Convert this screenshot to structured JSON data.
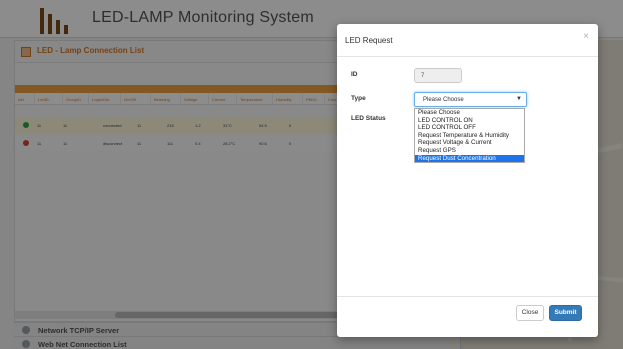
{
  "app": {
    "title": "LED-LAMP Monitoring System"
  },
  "panel": {
    "title": "LED - Lamp Connection List",
    "columns": [
      "Alrt",
      "LedID",
      "GroupID",
      "Login/Out",
      "On/Off",
      "Beaming",
      "Voltage",
      "Current",
      "Temperature",
      "Humidity",
      "PM10",
      "Conn"
    ],
    "rows": [
      {
        "status_color": "#27a844",
        "led_id": "11",
        "group_id": "11",
        "login": "connected",
        "onoff": "11",
        "voltage": "215",
        "current": "1.2",
        "temperature": "31°C",
        "humidity": "54.9",
        "pm10": "0"
      },
      {
        "status_color": "#d9433a",
        "led_id": "11",
        "group_id": "11",
        "login": "disconnect",
        "onoff": "11",
        "voltage": "111",
        "current": "0.4",
        "temperature": "28.2°C",
        "humidity": "90.6",
        "pm10": "0"
      }
    ]
  },
  "sections": {
    "network": "Network TCP/IP Server",
    "web": "Web Net Connection List"
  },
  "modal": {
    "title": "LED Request",
    "close_icon": "×",
    "id_label": "ID",
    "id_value": "7",
    "type_label": "Type",
    "type_selected": "Please Choose",
    "type_options": [
      "Please Choose",
      "LED CONTROL ON",
      "LED CONTROL OFF",
      "Request Temperature & Humidity",
      "Request Voltage & Current",
      "Request GPS",
      "Request Dust Concentration"
    ],
    "highlighted_option": "Request Dust Concentration",
    "status_label": "LED Status",
    "close_button": "Close",
    "submit_button": "Submit"
  },
  "colors": {
    "accent_orange": "#d27a2a",
    "primary_blue": "#337ab7",
    "highlight_blue": "#1e73e8"
  }
}
